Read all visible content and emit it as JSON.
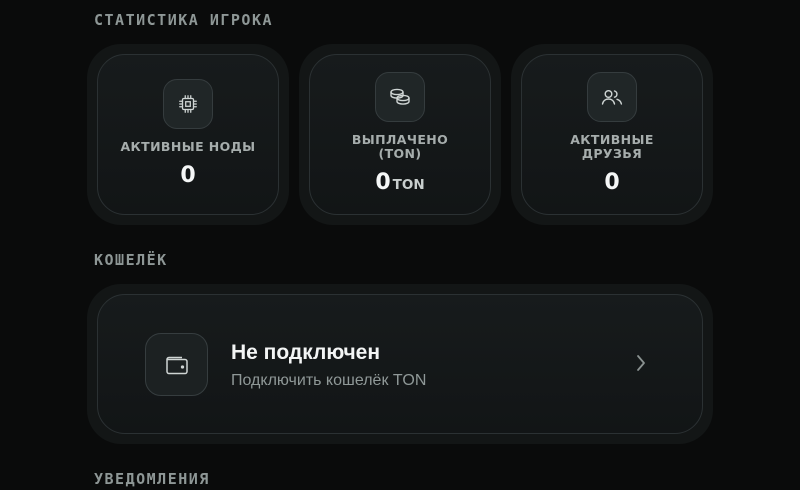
{
  "sections": {
    "stats_title": "СТАТИСТИКА ИГРОКА",
    "wallet_title": "КОШЕЛЁК",
    "notifications_title": "УВЕДОМЛЕНИЯ"
  },
  "stats": {
    "nodes": {
      "label": "АКТИВНЫЕ НОДЫ",
      "value": "0",
      "icon": "cpu-chip-icon"
    },
    "paid": {
      "label_line1": "ВЫПЛАЧЕНО",
      "label_line2": "(TON)",
      "value": "0",
      "unit": "TON",
      "icon": "coins-icon"
    },
    "friends": {
      "label_line1": "АКТИВНЫЕ",
      "label_line2": "ДРУЗЬЯ",
      "value": "0",
      "icon": "users-icon"
    }
  },
  "wallet": {
    "status": "Не подключен",
    "action": "Подключить кошелёк TON",
    "icon": "wallet-icon",
    "arrow_icon": "chevron-right-icon"
  },
  "colors": {
    "background": "#0a0b0b",
    "card": "#151819",
    "card_border": "#2b3133",
    "accent_text": "#f5f7f7",
    "muted_text": "#8e9796"
  }
}
